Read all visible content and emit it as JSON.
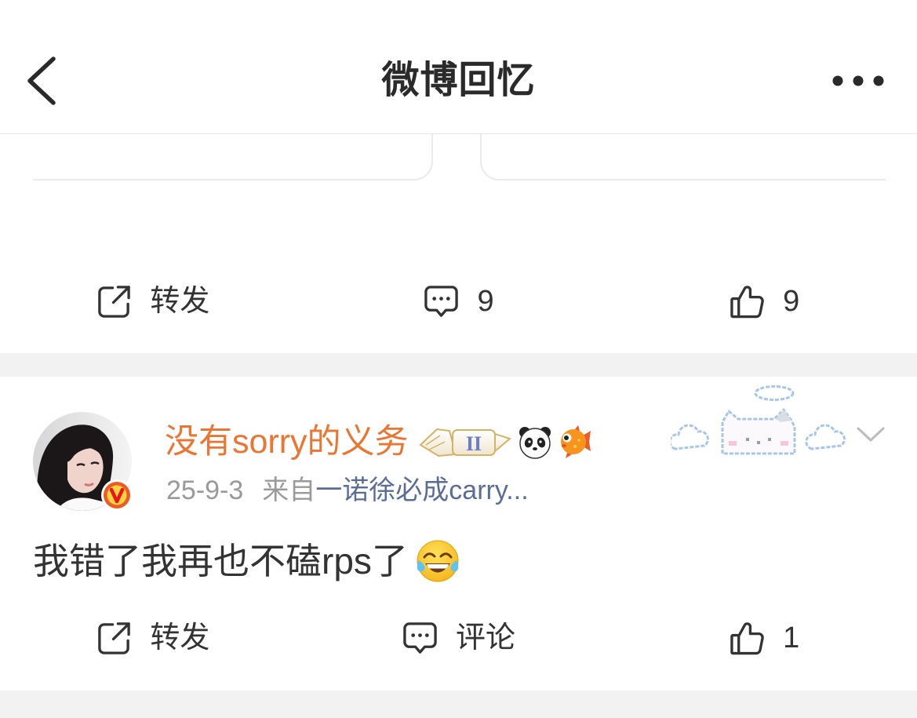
{
  "header": {
    "title": "微博回忆",
    "back_icon": "chevron-left-icon",
    "more_icon": "more-dots-icon"
  },
  "post_top": {
    "actions": [
      {
        "icon": "repost-icon",
        "label": "转发"
      },
      {
        "icon": "comment-icon",
        "label": "9"
      },
      {
        "icon": "like-icon",
        "label": "9"
      }
    ]
  },
  "post": {
    "author": {
      "name": "没有sorry的义务",
      "avatar_icon": "avatar-photo",
      "verified_icon": "verified-v-icon",
      "rank_badge": {
        "icon": "rank-badge-icon",
        "level": "II"
      },
      "emoji_badges": [
        "panda-icon",
        "pufferfish-icon"
      ],
      "decoration_icon": "cloud-cat-decoration",
      "menu_icon": "chevron-down-icon"
    },
    "meta": {
      "time": "25-9-3",
      "source_prefix": "来自",
      "source": "一诺徐必成carry..."
    },
    "content": {
      "text": "我错了我再也不磕rps了",
      "emoji_icon": "tears-of-joy-emoji"
    },
    "actions": [
      {
        "icon": "repost-icon",
        "label": "转发"
      },
      {
        "icon": "comment-icon",
        "label": "评论"
      },
      {
        "icon": "like-icon",
        "label": "1"
      }
    ]
  },
  "colors": {
    "name": "#eb7532",
    "link": "#5b6d96",
    "meta": "#9a9a9a",
    "text": "#333333",
    "separator": "#f2f2f2"
  }
}
